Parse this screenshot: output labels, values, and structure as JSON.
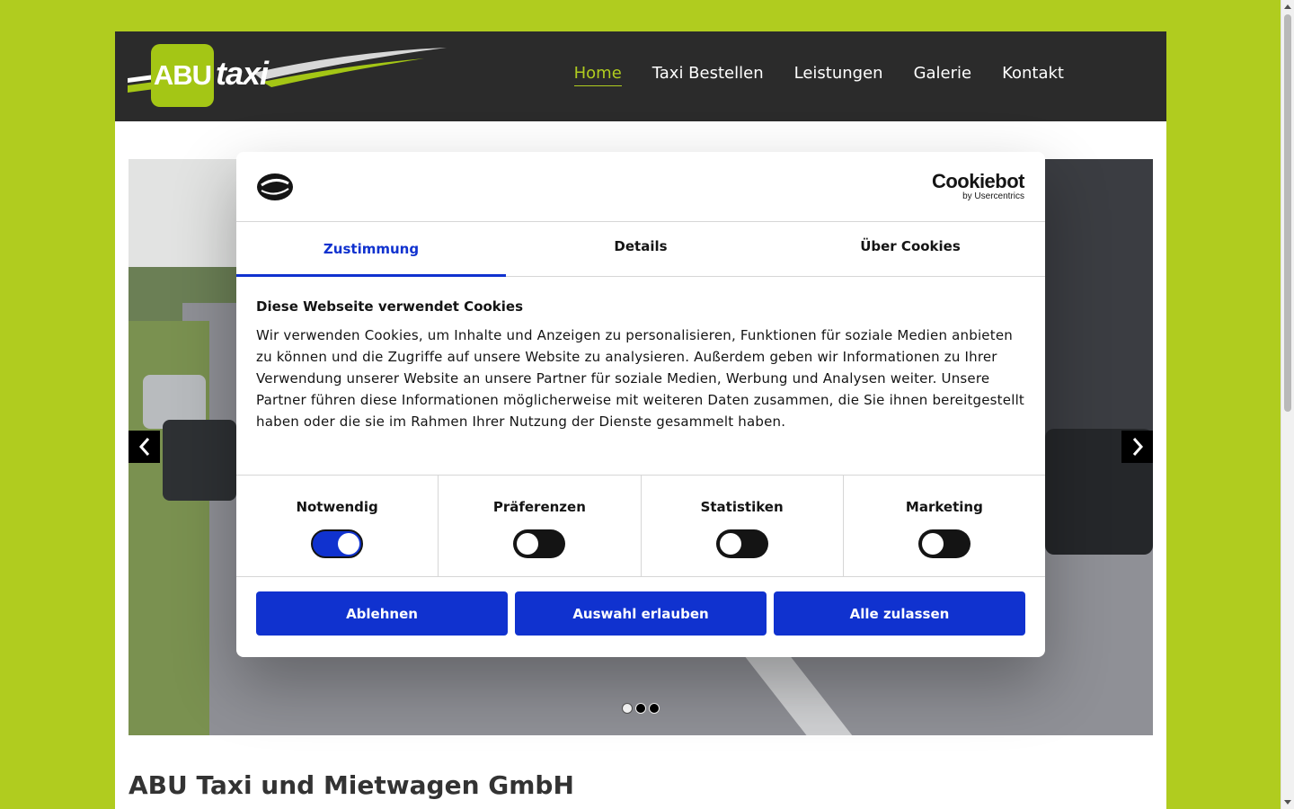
{
  "logo": {
    "box_text": "ABU",
    "script_text": "taxi"
  },
  "nav": {
    "items": [
      {
        "label": "Home",
        "active": true
      },
      {
        "label": "Taxi Bestellen"
      },
      {
        "label": "Leistungen"
      },
      {
        "label": "Galerie"
      },
      {
        "label": "Kontakt"
      }
    ]
  },
  "slider": {
    "dot_count": 3,
    "active_dot": 0
  },
  "site_title": "ABU Taxi und Mietwagen GmbH",
  "cookie": {
    "brand": "Cookiebot",
    "brand_sub": "by Usercentrics",
    "tabs": [
      "Zustimmung",
      "Details",
      "Über Cookies"
    ],
    "active_tab": 0,
    "heading": "Diese Webseite verwendet Cookies",
    "text": "Wir verwenden Cookies, um Inhalte und Anzeigen zu personalisieren, Funktionen für soziale Medien anbieten zu können und die Zugriffe auf unsere Website zu analysieren. Außerdem geben wir Informationen zu Ihrer Verwendung unserer Website an unsere Partner für soziale Medien, Werbung und Analysen weiter. Unsere Partner führen diese Informationen möglicherweise mit weiteren Daten zusammen, die Sie ihnen bereitgestellt haben oder die sie im Rahmen Ihrer Nutzung der Dienste gesammelt haben.",
    "consents": [
      {
        "label": "Notwendig",
        "on": true
      },
      {
        "label": "Präferenzen",
        "on": false
      },
      {
        "label": "Statistiken",
        "on": false
      },
      {
        "label": "Marketing",
        "on": false
      }
    ],
    "buttons": {
      "reject": "Ablehnen",
      "selection": "Auswahl erlauben",
      "accept_all": "Alle zulassen"
    }
  },
  "colors": {
    "brand_green": "#b0cc1f",
    "header_dark": "#2b2b2b",
    "cookie_blue": "#1032cf"
  }
}
